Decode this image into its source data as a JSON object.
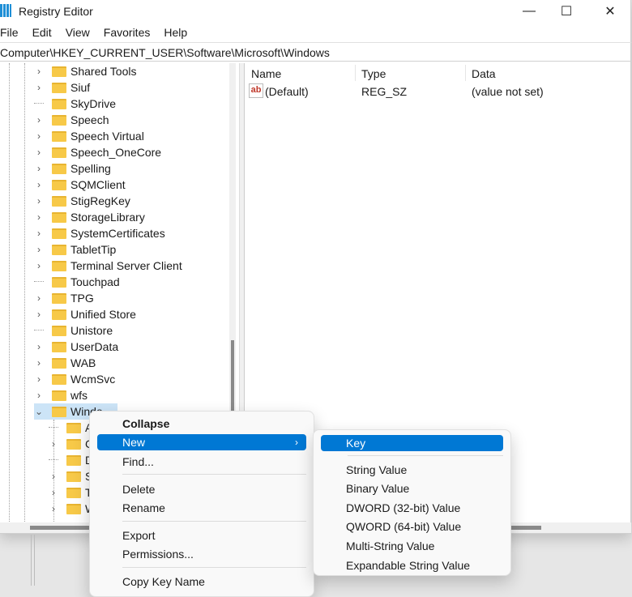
{
  "window": {
    "title": "Registry Editor",
    "minimize": "—",
    "maximize": "☐",
    "close": "✕"
  },
  "menubar": [
    "File",
    "Edit",
    "View",
    "Favorites",
    "Help"
  ],
  "address": "Computer\\HKEY_CURRENT_USER\\Software\\Microsoft\\Windows",
  "tree": [
    {
      "label": "Shared Tools",
      "expandable": true
    },
    {
      "label": "Siuf",
      "expandable": true
    },
    {
      "label": "SkyDrive",
      "expandable": false
    },
    {
      "label": "Speech",
      "expandable": true
    },
    {
      "label": "Speech Virtual",
      "expandable": true
    },
    {
      "label": "Speech_OneCore",
      "expandable": true
    },
    {
      "label": "Spelling",
      "expandable": true
    },
    {
      "label": "SQMClient",
      "expandable": true
    },
    {
      "label": "StigRegKey",
      "expandable": true
    },
    {
      "label": "StorageLibrary",
      "expandable": true
    },
    {
      "label": "SystemCertificates",
      "expandable": true
    },
    {
      "label": "TabletTip",
      "expandable": true
    },
    {
      "label": "Terminal Server Client",
      "expandable": true
    },
    {
      "label": "Touchpad",
      "expandable": false
    },
    {
      "label": "TPG",
      "expandable": true
    },
    {
      "label": "Unified Store",
      "expandable": true
    },
    {
      "label": "Unistore",
      "expandable": false
    },
    {
      "label": "UserData",
      "expandable": true
    },
    {
      "label": "WAB",
      "expandable": true
    },
    {
      "label": "WcmSvc",
      "expandable": true
    },
    {
      "label": "wfs",
      "expandable": true
    },
    {
      "label": "Windo",
      "expandable": true,
      "expanded": true,
      "selected": true
    }
  ],
  "children": [
    {
      "label": "As",
      "expandable": false
    },
    {
      "label": "Cu",
      "expandable": true
    },
    {
      "label": "DV",
      "expandable": false
    },
    {
      "label": "Sh",
      "expandable": true
    },
    {
      "label": "Ta",
      "expandable": true
    },
    {
      "label": "W",
      "expandable": true
    }
  ],
  "list": {
    "headers": [
      "Name",
      "Type",
      "Data"
    ],
    "rows": [
      {
        "name": "(Default)",
        "type": "REG_SZ",
        "data": "(value not set)",
        "icon": "ab"
      }
    ]
  },
  "context_menu": {
    "items": [
      "Collapse",
      "New",
      "Find...",
      "Delete",
      "Rename",
      "Export",
      "Permissions...",
      "Copy Key Name"
    ],
    "arrow": "›"
  },
  "submenu": {
    "items": [
      "Key",
      "String Value",
      "Binary Value",
      "DWORD (32-bit) Value",
      "QWORD (64-bit) Value",
      "Multi-String Value",
      "Expandable String Value"
    ]
  },
  "colors": {
    "accent": "#0078d4",
    "selection": "#cce4f7",
    "folder": "#f7c948"
  }
}
